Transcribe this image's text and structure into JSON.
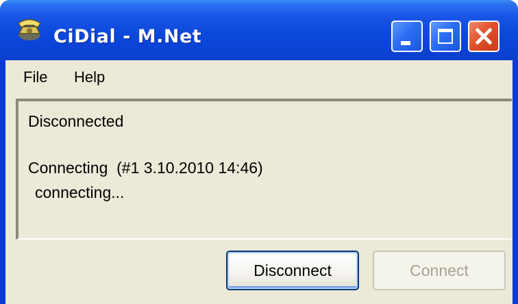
{
  "window": {
    "title": "CiDial - M.Net",
    "app_icon": "telephone-icon",
    "controls": [
      "minimize-icon",
      "maximize-icon",
      "close-icon"
    ]
  },
  "menu": {
    "items": [
      {
        "label": "File"
      },
      {
        "label": "Help"
      }
    ]
  },
  "status": {
    "lines": [
      "Disconnected",
      "Connecting  (#1 3.10.2010 14:46)",
      "connecting..."
    ]
  },
  "buttons": {
    "disconnect": {
      "label": "Disconnect",
      "enabled": true
    },
    "connect": {
      "label": "Connect",
      "enabled": false
    }
  },
  "colors": {
    "titlebar": "#0a43d6",
    "face": "#ece9d8",
    "close_button": "#e0532c",
    "disabled_text": "#a5a394"
  }
}
